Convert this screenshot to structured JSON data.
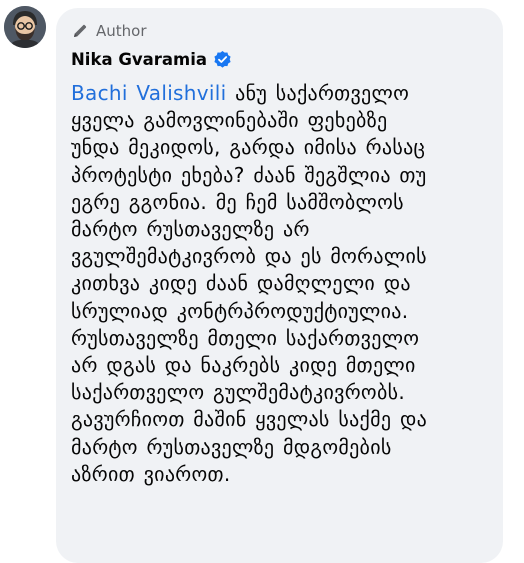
{
  "comment": {
    "badge_label": "Author",
    "commenter_name": "Nika Gvaramia",
    "mention": "Bachi Valishvili",
    "lines": [
      " ანუ საქართველო",
      "ყველა გამოვლინებაში ფეხებზე",
      "უნდა მეკიდოს, გარდა იმისა რასაც",
      "პროტესტი ეხება? ძაან შეგშლია თუ",
      "ეგრე გგონია. მე ჩემ სამშობლოს",
      "მარტო რუსთაველზე არ",
      "ვგულშემატკივრობ და ეს მორალის",
      "კითხვა კიდე ძაან დამღლელი და",
      "სრულიად კონტრპროდუქტიულია.",
      "რუსთაველზე მთელი საქართველო",
      "არ დგას და ნაკრებს კიდე მთელი",
      "საქართველო გულშემატკივრობს.",
      "გავურჩიოთ მაშინ ყველას საქმე და",
      "მარტო რუსთაველზე მდგომების",
      "აზრით ვიაროთ."
    ]
  },
  "icons": {
    "avatar": "avatar-cartoon-bearded-man",
    "badge": "pencil-icon",
    "verified": "verified-badge-icon"
  },
  "colors": {
    "bubble_background": "#f0f2f5",
    "mention_link": "#216fdb",
    "verified_badge": "#1877f2",
    "secondary_text": "#65676b"
  }
}
